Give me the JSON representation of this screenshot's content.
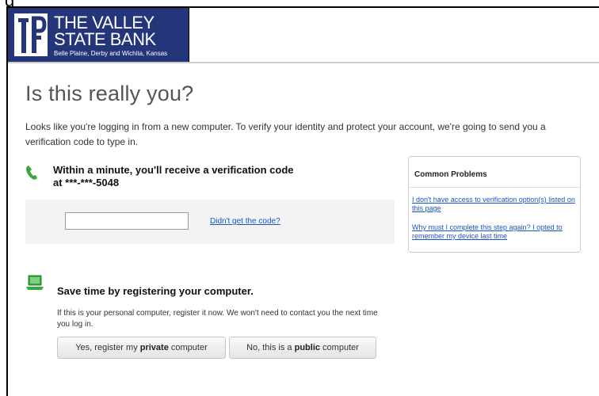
{
  "top_cut_text": "g",
  "header": {
    "bank_name_line1": "THE VALLEY",
    "bank_name_line2": "STATE BANK",
    "tagline": "Belle Plaine, Derby and Wichita, Kansas",
    "brand_color": "#24357a"
  },
  "page": {
    "title": "Is this really you?",
    "intro": "Looks like you're logging in from a new computer. To verify your identity and protect your account, we're going to send you a verification code to type in."
  },
  "verification": {
    "icon": "phone-icon",
    "heading": "Within a minute, you'll receive a verification code at ***-***-5048",
    "code_value": "",
    "code_placeholder": "",
    "resend_link": "Didn't get the code?"
  },
  "common_problems": {
    "title": "Common Problems",
    "links": [
      "I don't have access to verification option(s) listed on this page",
      "Why must I complete this step again? I opted to remember my device last time"
    ]
  },
  "register": {
    "icon": "laptop-icon",
    "heading": "Save time by registering your computer.",
    "description": "If this is your personal computer, register it now. We won't need to contact you the next time you log in.",
    "private_button": {
      "prefix": "Yes, register my ",
      "bold": "private",
      "suffix": " computer"
    },
    "public_button": {
      "prefix": "No, this is a ",
      "bold": "public",
      "suffix": " computer"
    }
  },
  "colors": {
    "link": "#1a55c8",
    "icon_green": "#3aa53a"
  }
}
